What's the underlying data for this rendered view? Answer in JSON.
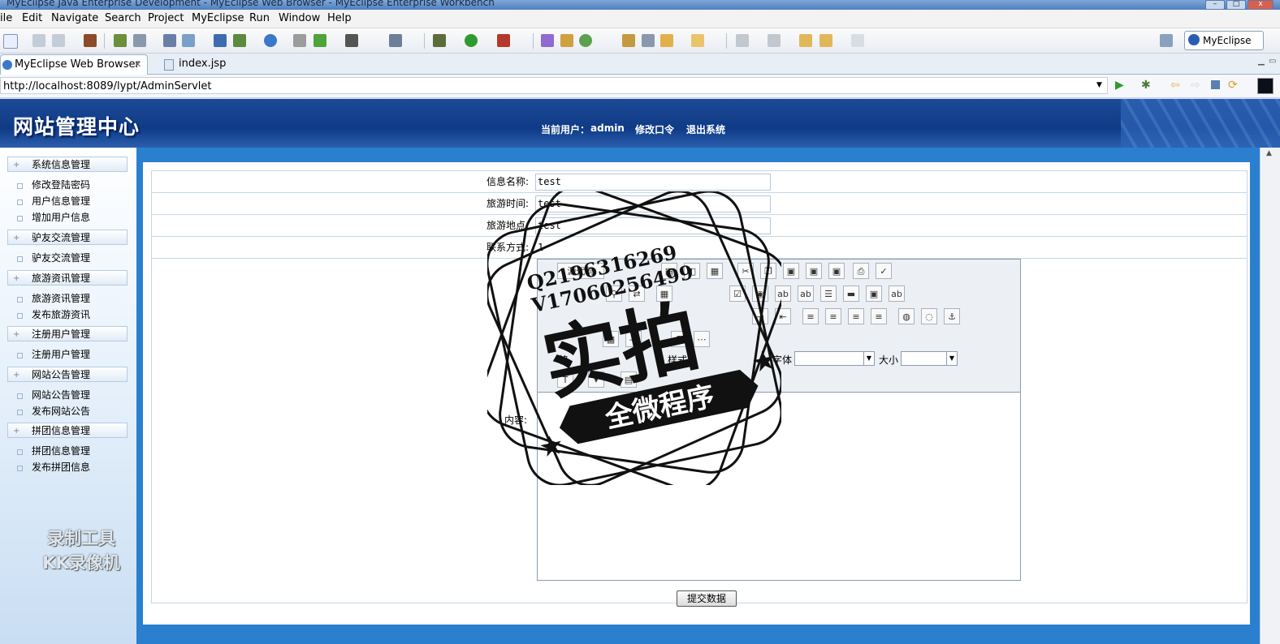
{
  "window": {
    "title": "MyEclipse Java Enterprise Development - MyEclipse Web Browser - MyEclipse Enterprise Workbench"
  },
  "menu": [
    "ile",
    "Edit",
    "Navigate",
    "Search",
    "Project",
    "MyEclipse",
    "Run",
    "Window",
    "Help"
  ],
  "toolbar": {
    "perspective_label": "MyEclipse J..."
  },
  "tabs": [
    {
      "label": "MyEclipse Web Browser",
      "active": true
    },
    {
      "label": "index.jsp",
      "active": false
    }
  ],
  "browser": {
    "url": "http://localhost:8089/lypt/AdminServlet"
  },
  "header": {
    "site_title": "网站管理中心",
    "current_user_label": "当前用户：",
    "current_user": "admin",
    "change_password": "修改口令",
    "logout": "退出系统"
  },
  "sidebar": {
    "groups": [
      {
        "title": "系统信息管理",
        "links": [
          "修改登陆密码",
          "用户信息管理",
          "增加用户信息"
        ]
      },
      {
        "title": "驴友交流管理",
        "links": [
          "驴友交流管理"
        ]
      },
      {
        "title": "旅游资讯管理",
        "links": [
          "旅游资讯管理",
          "发布旅游资讯"
        ]
      },
      {
        "title": "注册用户管理",
        "links": [
          "注册用户管理"
        ]
      },
      {
        "title": "网站公告管理",
        "links": [
          "网站公告管理",
          "发布网站公告"
        ]
      },
      {
        "title": "拼团信息管理",
        "links": [
          "拼团信息管理",
          "发布拼团信息"
        ]
      }
    ],
    "watermark": [
      "录制工具",
      "KK录像机"
    ]
  },
  "form": {
    "fields": [
      {
        "label": "信息名称:",
        "value": "test"
      },
      {
        "label": "旅游时间:",
        "value": "test"
      },
      {
        "label": "旅游地点:",
        "value": "test"
      },
      {
        "label": "联系方式:",
        "value": "1"
      }
    ],
    "content_label": "内容:",
    "editor": {
      "source_label": "源代码",
      "style_label": "样式",
      "font_label": "字体",
      "size_label": "大小",
      "format_label": "格"
    },
    "submit_label": "提交数据"
  },
  "stamp": {
    "line1": "Q2196316269",
    "line2": "V17060256499",
    "big": "实拍",
    "banner": "全微程序"
  }
}
